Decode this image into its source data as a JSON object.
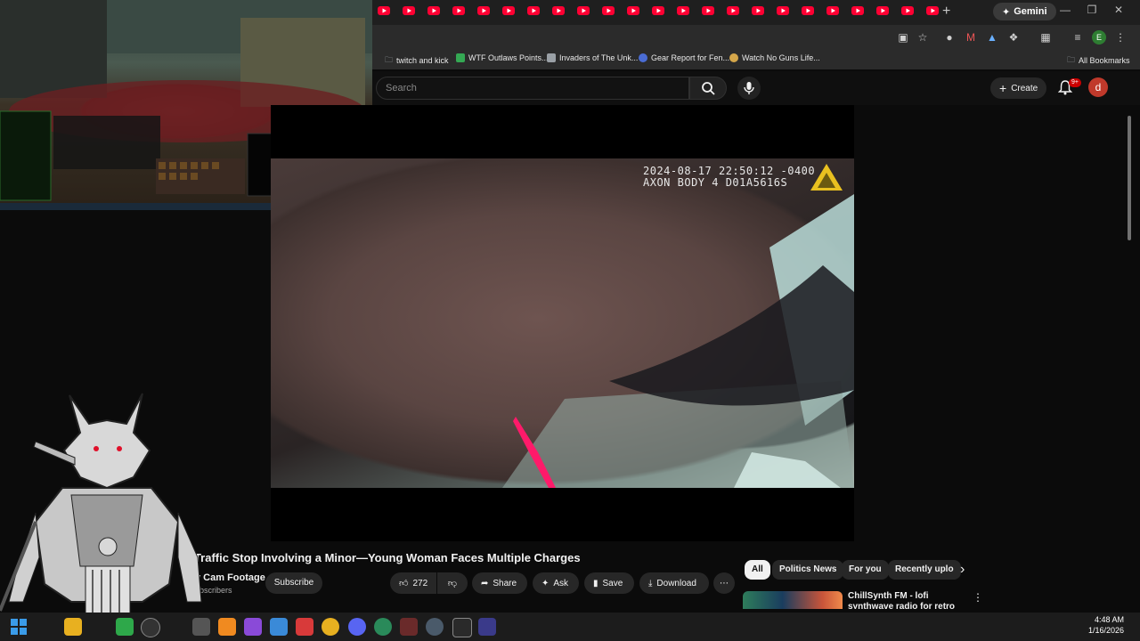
{
  "browser": {
    "gemini_label": "Gemini",
    "tab_count": 23,
    "bookmarks": [
      {
        "label": "twitch and kick",
        "color": "#9aa0a6"
      },
      {
        "label": "WTF Outlaws Points...",
        "color": "#34a853"
      },
      {
        "label": "Invaders of The Unk...",
        "color": "#9aa0a6"
      },
      {
        "label": "Gear Report for Fen...",
        "color": "#4a6cd4"
      },
      {
        "label": "Watch No Guns Life...",
        "color": "#d4a64a"
      }
    ],
    "all_bookmarks": "All Bookmarks",
    "profile_initial": "E"
  },
  "youtube": {
    "search_placeholder": "Search",
    "create_label": "Create",
    "notifications": "9+",
    "avatar_initial": "d"
  },
  "video": {
    "timestamp_line1": "2024-08-17 22:50:12 -0400",
    "timestamp_line2": "AXON BODY 4 D01A5616S",
    "title": "t Traffic Stop Involving a Minor—Young Woman Faces Multiple Charges",
    "channel": "y Cam Footage",
    "subscribers": "ubscribers",
    "subscribe_label": "Subscribe",
    "likes": "272",
    "share_label": "Share",
    "ask_label": "Ask",
    "save_label": "Save",
    "download_label": "Download"
  },
  "chips": [
    "All",
    "Politics News",
    "For you",
    "Recently uplo"
  ],
  "recommendation": {
    "title": "ChillSynth FM - lofi synthwave radio for retro dreaming"
  },
  "taskbar": {
    "time": "4:48 AM",
    "date": "1/16/2026"
  },
  "colors": {
    "youtube_red": "#ff0033",
    "brand_accent": "#cc0000"
  }
}
